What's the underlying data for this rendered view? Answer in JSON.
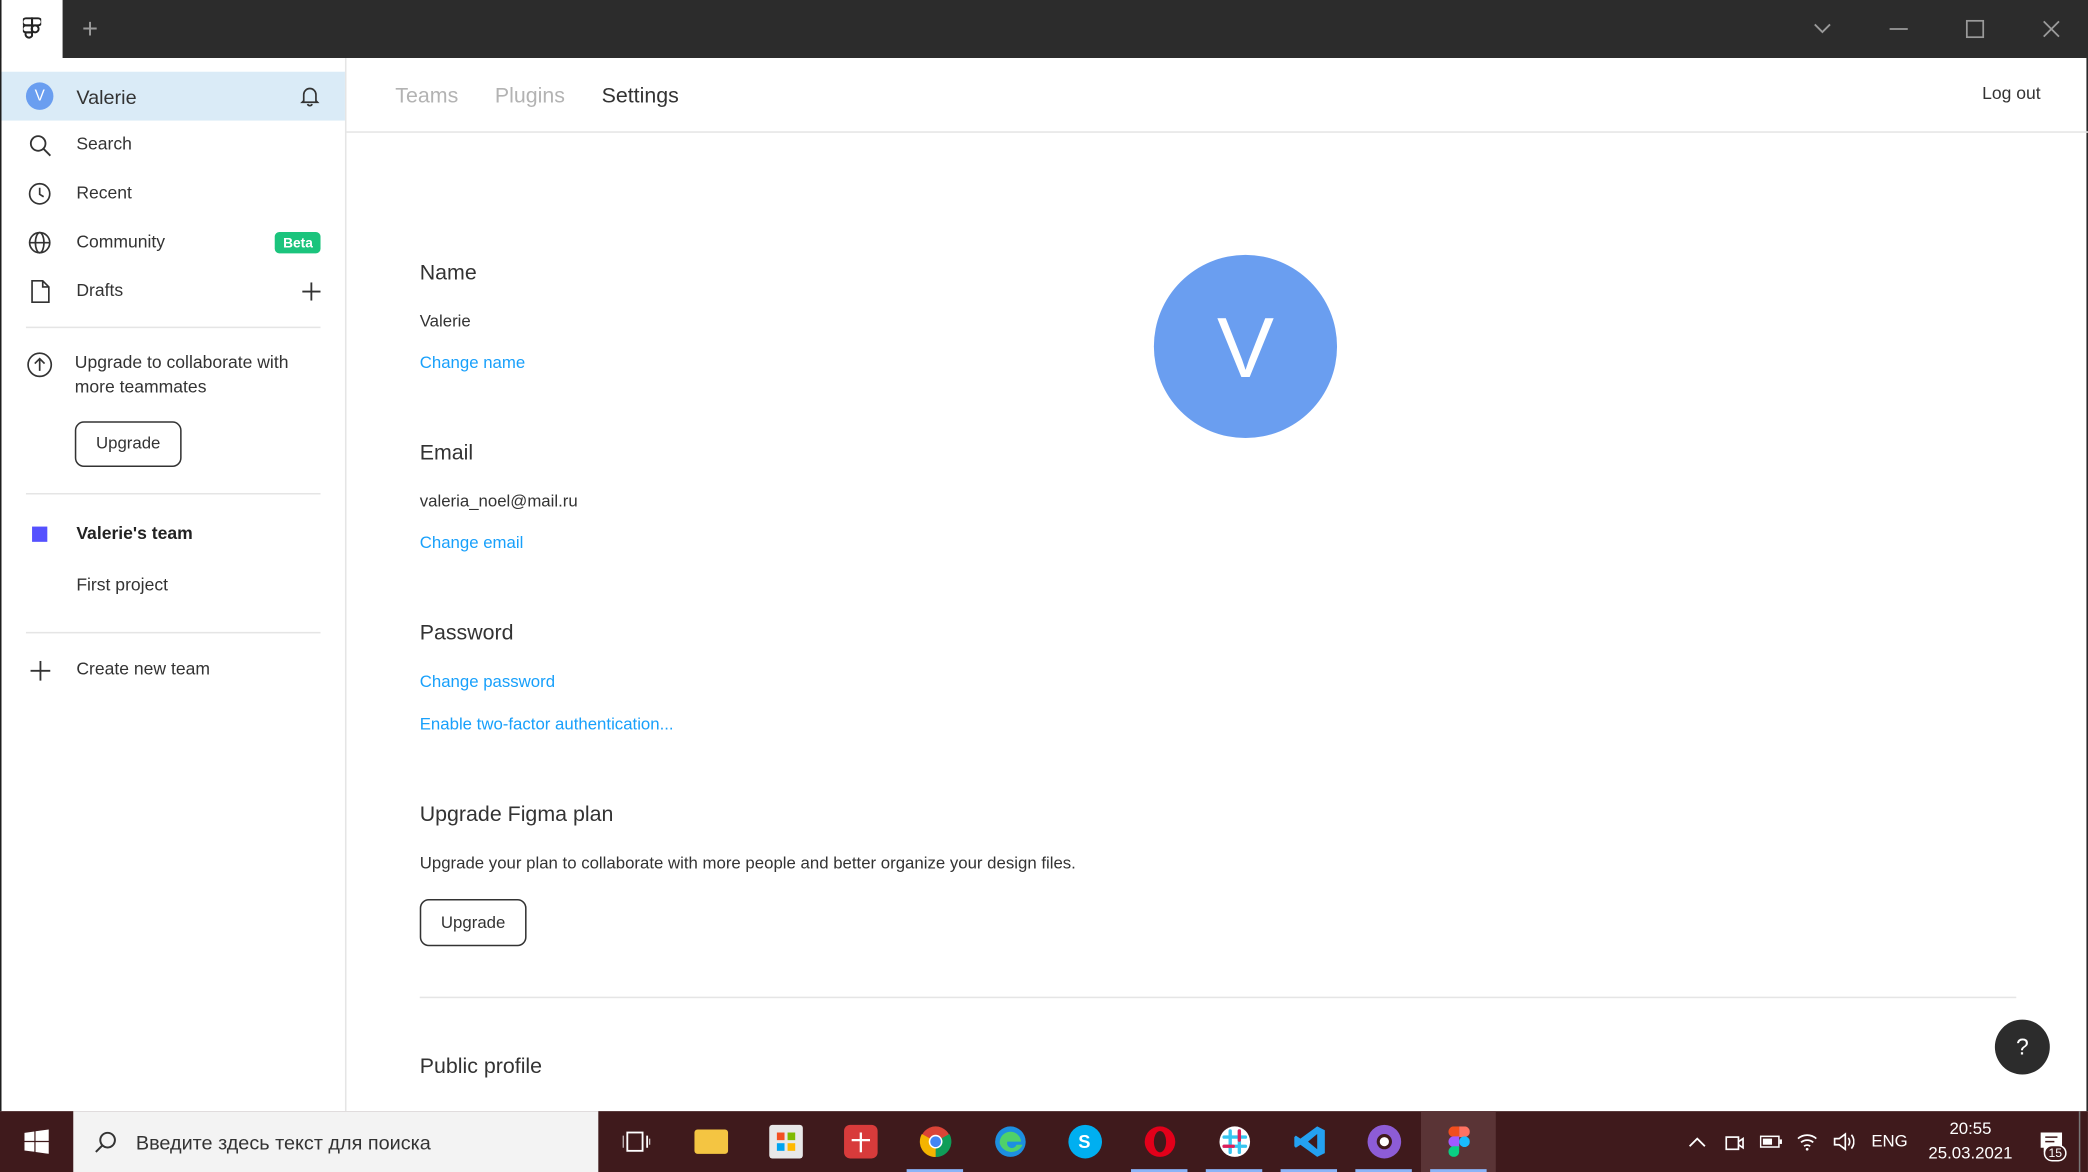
{
  "titlebar": {
    "add_tab_label": "+"
  },
  "sidebar": {
    "user": {
      "initial": "V",
      "name": "Valerie"
    },
    "nav": {
      "search": "Search",
      "recent": "Recent",
      "community": "Community",
      "community_badge": "Beta",
      "drafts": "Drafts"
    },
    "upgrade_prompt": "Upgrade to collaborate with more teammates",
    "upgrade_button": "Upgrade",
    "team_name": "Valerie's team",
    "project_name": "First project",
    "create_team": "Create new team"
  },
  "header": {
    "tabs": [
      "Teams",
      "Plugins",
      "Settings"
    ],
    "active_tab": "Settings",
    "logout": "Log out"
  },
  "main": {
    "avatar_initial": "V",
    "name_title": "Name",
    "name_value": "Valerie",
    "change_name": "Change name",
    "email_title": "Email",
    "email_value": "valeria_noel@mail.ru",
    "change_email": "Change email",
    "password_title": "Password",
    "change_password": "Change password",
    "enable_2fa": "Enable two-factor authentication...",
    "plan_title": "Upgrade Figma plan",
    "plan_desc": "Upgrade your plan to collaborate with more people and better organize your design files.",
    "plan_button": "Upgrade",
    "public_profile_title": "Public profile",
    "help_label": "?"
  },
  "taskbar": {
    "search_placeholder": "Введите здесь текст для поиска",
    "language": "ENG",
    "time": "20:55",
    "date": "25.03.2021",
    "notification_count": "15"
  },
  "colors": {
    "accent_link": "#18a0fb",
    "avatar": "#6a9ef0",
    "beta_badge": "#1bc47d",
    "team_color": "#5551ff",
    "active_row": "#daebf7",
    "titlebar": "#2c2c2c",
    "taskbar": "#3f1a1c"
  }
}
